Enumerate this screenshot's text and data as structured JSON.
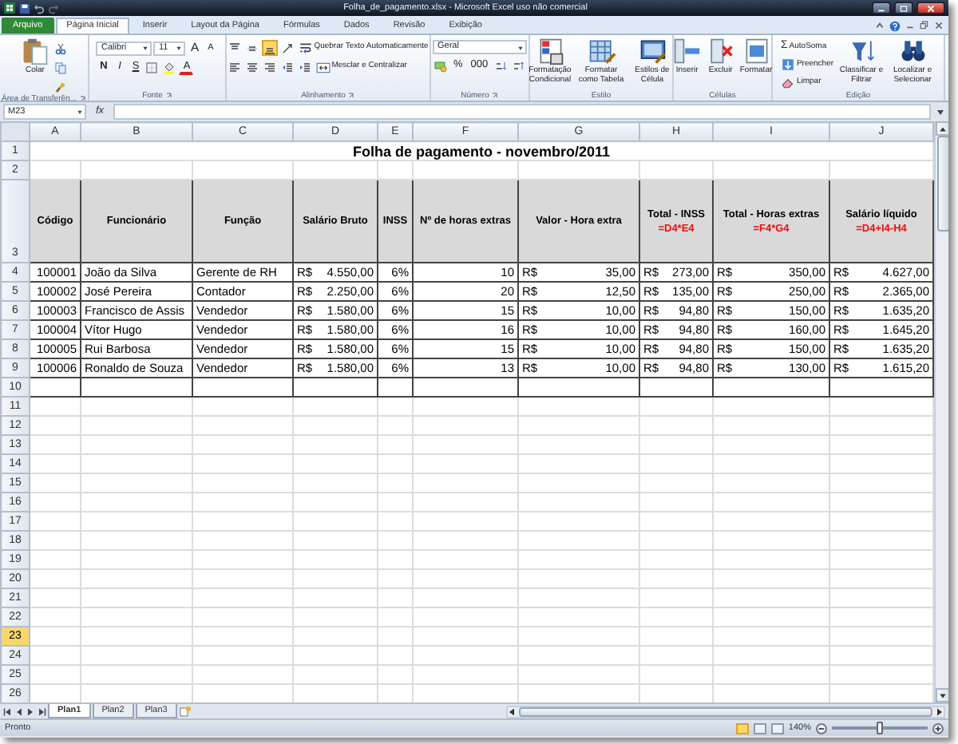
{
  "window": {
    "title": "Folha_de_pagamento.xlsx - Microsoft Excel uso não comercial"
  },
  "tabs": [
    {
      "label": "Arquivo",
      "kind": "file",
      "selected": false
    },
    {
      "label": "Página Inicial",
      "kind": "tab",
      "selected": true
    },
    {
      "label": "Inserir",
      "kind": "tab",
      "selected": false
    },
    {
      "label": "Layout da Página",
      "kind": "tab",
      "selected": false
    },
    {
      "label": "Fórmulas",
      "kind": "tab",
      "selected": false
    },
    {
      "label": "Dados",
      "kind": "tab",
      "selected": false
    },
    {
      "label": "Revisão",
      "kind": "tab",
      "selected": false
    },
    {
      "label": "Exibição",
      "kind": "tab",
      "selected": false
    }
  ],
  "ribbon": {
    "groups": [
      {
        "label": "Área de Transferên...",
        "launcher": true,
        "blocks": [
          {
            "kind": "large",
            "label": "Colar"
          },
          {
            "kind": "stack",
            "lines": [
              [
                {
                  "kind": "icon"
                }
              ],
              [
                {
                  "kind": "icon"
                }
              ],
              [
                {
                  "kind": "icon"
                }
              ]
            ]
          }
        ]
      },
      {
        "label": "Fonte",
        "launcher": true,
        "blocks": [
          {
            "kind": "stack",
            "lines": [
              [
                {
                  "kind": "field",
                  "value": "Calibri"
                },
                {
                  "kind": "field",
                  "value": "11"
                },
                {
                  "kind": "grow",
                  "text": "A"
                },
                {
                  "kind": "shrink",
                  "text": "A"
                }
              ],
              [
                {
                  "kind": "bold",
                  "text": "N",
                  "selected": false
                },
                {
                  "kind": "italic",
                  "text": "I",
                  "selected": false
                },
                {
                  "kind": "underline",
                  "text": "S",
                  "selected": false
                },
                {
                  "kind": "icon"
                },
                {
                  "kind": "icon"
                },
                {
                  "kind": "fontcolor",
                  "text": "A"
                }
              ]
            ]
          }
        ]
      },
      {
        "label": "Alinhamento",
        "launcher": true,
        "blocks": [
          {
            "kind": "stack",
            "lines": [
              [
                {
                  "kind": "icon",
                  "selected": false
                },
                {
                  "kind": "icon",
                  "selected": false
                },
                {
                  "kind": "icon",
                  "selected": true
                },
                {
                  "kind": "icon"
                },
                {
                  "kind": "small",
                  "label": "Quebrar Texto Automaticamente"
                }
              ],
              [
                {
                  "kind": "icon",
                  "selected": false
                },
                {
                  "kind": "icon",
                  "selected": false
                },
                {
                  "kind": "icon",
                  "selected": false
                },
                {
                  "kind": "icon"
                },
                {
                  "kind": "icon"
                },
                {
                  "kind": "small",
                  "label": "Mesclar e Centralizar"
                }
              ]
            ]
          }
        ]
      },
      {
        "label": "Número",
        "launcher": true,
        "blocks": [
          {
            "kind": "stack",
            "lines": [
              [
                {
                  "kind": "field",
                  "value": "Geral"
                }
              ],
              [
                {
                  "kind": "icon"
                },
                {
                  "kind": "glyph",
                  "text": "%"
                },
                {
                  "kind": "glyph",
                  "text": "000"
                },
                {
                  "kind": "icon"
                },
                {
                  "kind": "icon"
                }
              ]
            ]
          }
        ]
      },
      {
        "label": "Estilo",
        "launcher": false,
        "blocks": [
          {
            "kind": "large",
            "label": "Formatação Condicional"
          },
          {
            "kind": "large",
            "label": "Formatar como Tabela"
          },
          {
            "kind": "large",
            "label": "Estilos de Célula"
          }
        ]
      },
      {
        "label": "Células",
        "launcher": false,
        "blocks": [
          {
            "kind": "large",
            "label": "Inserir"
          },
          {
            "kind": "large",
            "label": "Excluir"
          },
          {
            "kind": "large",
            "label": "Formatar"
          }
        ]
      },
      {
        "label": "Edição",
        "launcher": false,
        "blocks": [
          {
            "kind": "stack",
            "lines": [
              [
                {
                  "kind": "small",
                  "glyph": "Σ",
                  "label": "AutoSoma"
                }
              ],
              [
                {
                  "kind": "small",
                  "label": "Preencher"
                }
              ],
              [
                {
                  "kind": "small",
                  "label": "Limpar"
                }
              ]
            ]
          },
          {
            "kind": "large",
            "label": "Classificar e Filtrar"
          },
          {
            "kind": "large",
            "label": "Localizar e Selecionar"
          }
        ]
      }
    ]
  },
  "formula_bar": {
    "name_box": "M23",
    "function_label": "fx"
  },
  "sheet": {
    "title": "Folha de pagamento - novembro/2011",
    "columns": [
      {
        "letter": "A",
        "header": "Código",
        "kind": "number"
      },
      {
        "letter": "B",
        "header": "Funcionário",
        "kind": "text"
      },
      {
        "letter": "C",
        "header": "Função",
        "kind": "text"
      },
      {
        "letter": "D",
        "header": "Salário Bruto",
        "kind": "currency"
      },
      {
        "letter": "E",
        "header": "INSS",
        "kind": "number"
      },
      {
        "letter": "F",
        "header": "Nº de horas extras",
        "kind": "number"
      },
      {
        "letter": "G",
        "header": "Valor - Hora extra",
        "kind": "currency"
      },
      {
        "letter": "H",
        "header": "Total - INSS",
        "formula": "=D4*E4",
        "kind": "currency"
      },
      {
        "letter": "I",
        "header": "Total - Horas extras",
        "formula": "=F4*G4",
        "kind": "currency"
      },
      {
        "letter": "J",
        "header": "Salário líquido",
        "formula": "=D4+I4-H4",
        "kind": "currency"
      }
    ],
    "records": [
      {
        "cells": [
          "100001",
          "João da Silva",
          "Gerente de RH",
          {
            "symbol": "R$",
            "amount": "4.550,00"
          },
          "6%",
          "10",
          {
            "symbol": "R$",
            "amount": "35,00"
          },
          {
            "symbol": "R$",
            "amount": "273,00"
          },
          {
            "symbol": "R$",
            "amount": "350,00"
          },
          {
            "symbol": "R$",
            "amount": "4.627,00"
          }
        ]
      },
      {
        "cells": [
          "100002",
          "José Pereira",
          "Contador",
          {
            "symbol": "R$",
            "amount": "2.250,00"
          },
          "6%",
          "20",
          {
            "symbol": "R$",
            "amount": "12,50"
          },
          {
            "symbol": "R$",
            "amount": "135,00"
          },
          {
            "symbol": "R$",
            "amount": "250,00"
          },
          {
            "symbol": "R$",
            "amount": "2.365,00"
          }
        ]
      },
      {
        "cells": [
          "100003",
          "Francisco de Assis",
          "Vendedor",
          {
            "symbol": "R$",
            "amount": "1.580,00"
          },
          "6%",
          "15",
          {
            "symbol": "R$",
            "amount": "10,00"
          },
          {
            "symbol": "R$",
            "amount": "94,80"
          },
          {
            "symbol": "R$",
            "amount": "150,00"
          },
          {
            "symbol": "R$",
            "amount": "1.635,20"
          }
        ]
      },
      {
        "cells": [
          "100004",
          "Vítor Hugo",
          "Vendedor",
          {
            "symbol": "R$",
            "amount": "1.580,00"
          },
          "6%",
          "16",
          {
            "symbol": "R$",
            "amount": "10,00"
          },
          {
            "symbol": "R$",
            "amount": "94,80"
          },
          {
            "symbol": "R$",
            "amount": "160,00"
          },
          {
            "symbol": "R$",
            "amount": "1.645,20"
          }
        ]
      },
      {
        "cells": [
          "100005",
          "Rui Barbosa",
          "Vendedor",
          {
            "symbol": "R$",
            "amount": "1.580,00"
          },
          "6%",
          "15",
          {
            "symbol": "R$",
            "amount": "10,00"
          },
          {
            "symbol": "R$",
            "amount": "94,80"
          },
          {
            "symbol": "R$",
            "amount": "150,00"
          },
          {
            "symbol": "R$",
            "amount": "1.635,20"
          }
        ]
      },
      {
        "cells": [
          "100006",
          "Ronaldo de Souza",
          "Vendedor",
          {
            "symbol": "R$",
            "amount": "1.580,00"
          },
          "6%",
          "13",
          {
            "symbol": "R$",
            "amount": "10,00"
          },
          {
            "symbol": "R$",
            "amount": "94,80"
          },
          {
            "symbol": "R$",
            "amount": "130,00"
          },
          {
            "symbol": "R$",
            "amount": "1.615,20"
          }
        ]
      }
    ],
    "row_headers": [
      {
        "label": "1",
        "selected": false
      },
      {
        "label": "2",
        "selected": false
      },
      {
        "label": "3",
        "selected": false
      },
      {
        "label": "4",
        "selected": false
      },
      {
        "label": "5",
        "selected": false
      },
      {
        "label": "6",
        "selected": false
      },
      {
        "label": "7",
        "selected": false
      },
      {
        "label": "8",
        "selected": false
      },
      {
        "label": "9",
        "selected": false
      },
      {
        "label": "10",
        "selected": false
      },
      {
        "label": "11",
        "selected": false
      },
      {
        "label": "12",
        "selected": false
      },
      {
        "label": "13",
        "selected": false
      },
      {
        "label": "14",
        "selected": false
      },
      {
        "label": "15",
        "selected": false
      },
      {
        "label": "16",
        "selected": false
      },
      {
        "label": "17",
        "selected": false
      },
      {
        "label": "18",
        "selected": false
      },
      {
        "label": "19",
        "selected": false
      },
      {
        "label": "20",
        "selected": false
      },
      {
        "label": "21",
        "selected": false
      },
      {
        "label": "22",
        "selected": false
      },
      {
        "label": "23",
        "selected": true
      },
      {
        "label": "24",
        "selected": false
      },
      {
        "label": "25",
        "selected": false
      },
      {
        "label": "26",
        "selected": false
      }
    ]
  },
  "sheet_tabs": [
    {
      "label": "Plan1",
      "selected": true
    },
    {
      "label": "Plan2",
      "selected": false
    },
    {
      "label": "Plan3",
      "selected": false
    }
  ],
  "status_bar": {
    "status": "Pronto",
    "views": [
      {
        "selected": true
      },
      {
        "selected": false
      },
      {
        "selected": false
      }
    ],
    "zoom": "140%",
    "zoom_slider": {
      "level": 0.5
    }
  }
}
